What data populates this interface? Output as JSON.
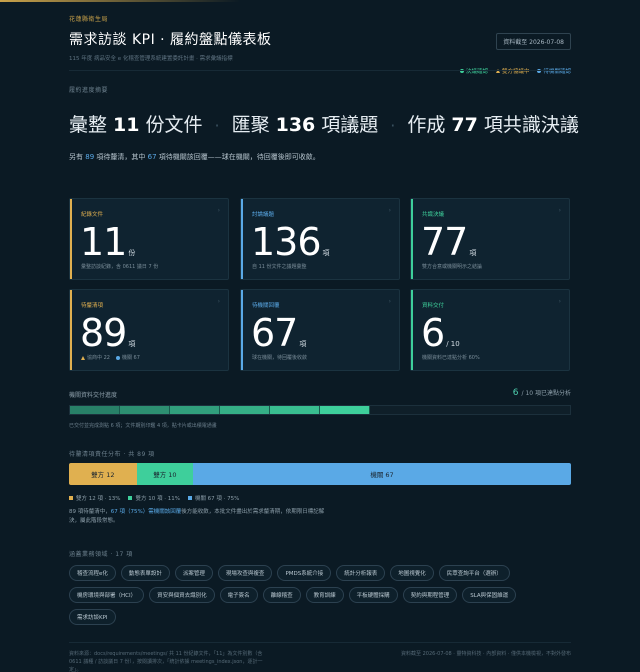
{
  "header": {
    "org": "花蓮縣衛生局",
    "title": "需求訪談 KPI · 履約盤點儀表板",
    "subtitle": "115 年度 病品安全 e 化稽查管理系統建置委託計畫 · 需求彙議指標",
    "date_badge": "資料截至 2026-07-08",
    "legend": [
      {
        "label": "決議確認",
        "color": "#3ecf9b",
        "shape": "dot"
      },
      {
        "label": "雙方協議中",
        "color": "#e0b050",
        "shape": "triangle"
      },
      {
        "label": "待機關確認",
        "color": "#5aa9e6",
        "shape": "dot"
      }
    ]
  },
  "summary_label": "履約進度摘要",
  "headline": {
    "p1_pre": "彙整",
    "p1_num": "11",
    "p1_post": "份文件",
    "p2_pre": "匯聚",
    "p2_num": "136",
    "p2_post": "項議題",
    "p3_pre": "作成",
    "p3_num": "77",
    "p3_post": "項共識決議",
    "sep": "·"
  },
  "lede": {
    "pre": "另有",
    "num1": "89",
    "mid1": "項待釐清，其中",
    "num2": "67",
    "post": "項待機關該回覆——球在機關，待回覆後即可收斂。"
  },
  "cards": [
    {
      "label": "紀錄文件",
      "value": "11",
      "unit": "份",
      "note": "彙整訪談紀錄，含 0611 議日 7 份",
      "color": "#e0b050"
    },
    {
      "label": "討論議題",
      "value": "136",
      "unit": "項",
      "note": "自 11 份文件之議題彙整",
      "color": "#5aa9e6"
    },
    {
      "label": "共識決議",
      "value": "77",
      "unit": "項",
      "note": "雙方合意或機關明示之結論",
      "color": "#3ecf9b"
    },
    {
      "label": "待釐清項",
      "value": "89",
      "unit": "項",
      "note_a": "協商中 22",
      "note_b": "機關 67",
      "color": "#e0b050"
    },
    {
      "label": "待機關回覆",
      "value": "67",
      "unit": "項",
      "note": "球在機關，待回覆後收斂",
      "color": "#5aa9e6"
    },
    {
      "label": "資料交付",
      "value": "6",
      "unit": "/ 10",
      "note": "機關資料已達點分析 60%",
      "color": "#3ecf9b"
    }
  ],
  "delivery": {
    "title": "機關資料交付進度",
    "done": "6",
    "total_label": "/ 10 項已達點分析",
    "completed": 6,
    "total": 10,
    "note": "已交付並完成測點 6 項；文件期別印鑑 4 項，點卡片或出積電通畫"
  },
  "pending": {
    "title": "待釐清項責任分布 · 共 89 項",
    "segments": [
      {
        "label": "雙方 12",
        "value": 12,
        "color": "#e0b050"
      },
      {
        "label": "雙方 10",
        "value": 10,
        "color": "#3ecf9b"
      },
      {
        "label": "機關 67",
        "value": 67,
        "color": "#5aa9e6"
      }
    ],
    "legend": [
      "雙方 12 項 · 13%",
      "雙方 10 項 · 11%",
      "機關 67 項 · 75%"
    ],
    "note_pre": "89 項待釐清中，",
    "note_hl": "67 項（75%）需機關該回覆",
    "note_post": "後方能收斂，本批文件盡出於需求釐清期，依期限日標記解決，屬此階段常態。"
  },
  "domains": {
    "title": "涵蓋業務領域 · 17 項",
    "tags": [
      "稽查流程e化",
      "動態表單設計",
      "派案管理",
      "現場攻查與複查",
      "PMDS系統介接",
      "統計分析報表",
      "地圖視覺化",
      "民眾查詢平台（選辦）",
      "機房環境與部署（HCI）",
      "資安與個資去識別化",
      "電子簽名",
      "離線稽查",
      "教育訓練",
      "平板硬體採購",
      "契約與期程管理",
      "SLA與保固維運",
      "需求訪談KPI"
    ]
  },
  "footer": {
    "left": "資料來源：docs/requirements/meetings/ 共 11 份紀錄文件，「11」為文件別數（含 0611 議種 / 訪談議日 7 份），按閱讀排次，「統計依據 meetings_index.json，逐計一定」。",
    "right": "資料截至 2026-07-08 · 靈特資科技 · 內部資料 · 僅供本機檢視，不對外發布"
  }
}
